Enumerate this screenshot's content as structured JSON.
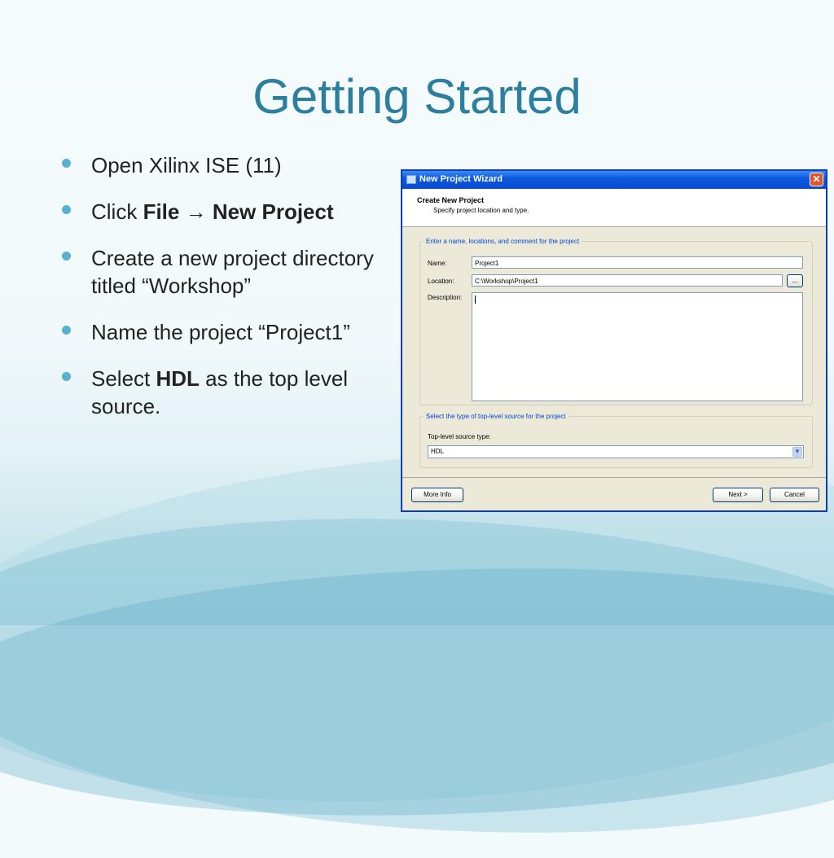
{
  "slide": {
    "title": "Getting Started",
    "bullets": [
      {
        "text": "Open Xilinx ISE (11)"
      },
      {
        "pre": "Click ",
        "bold1": "File",
        "arrow": " → ",
        "bold2": "New Project"
      },
      {
        "text": "Create a new project directory titled “Workshop”"
      },
      {
        "text": "Name the project “Project1”"
      },
      {
        "pre": "Select ",
        "bold": "HDL",
        "post": " as the top level source."
      }
    ]
  },
  "dialog": {
    "title": "New Project Wizard",
    "header_title": "Create New Project",
    "header_subtitle": "Specify project location and type.",
    "group1_legend": "Enter a name, locations, and comment for the project",
    "name_label": "Name:",
    "name_value": "Project1",
    "location_label": "Location:",
    "location_value": "C:\\Workshop\\Project1",
    "browse_label": "...",
    "description_label": "Description:",
    "description_value": "",
    "group2_legend": "Select the type of top-level source for the project",
    "source_type_label": "Top-level source type:",
    "source_type_value": "HDL",
    "more_info_label": "More Info",
    "next_label": "Next >",
    "cancel_label": "Cancel",
    "close_glyph": "✕"
  },
  "colors": {
    "title": "#2d7f9e",
    "bullet": "#58b2cf",
    "titlebar": "#0b5adf",
    "legend": "#0046d5"
  }
}
